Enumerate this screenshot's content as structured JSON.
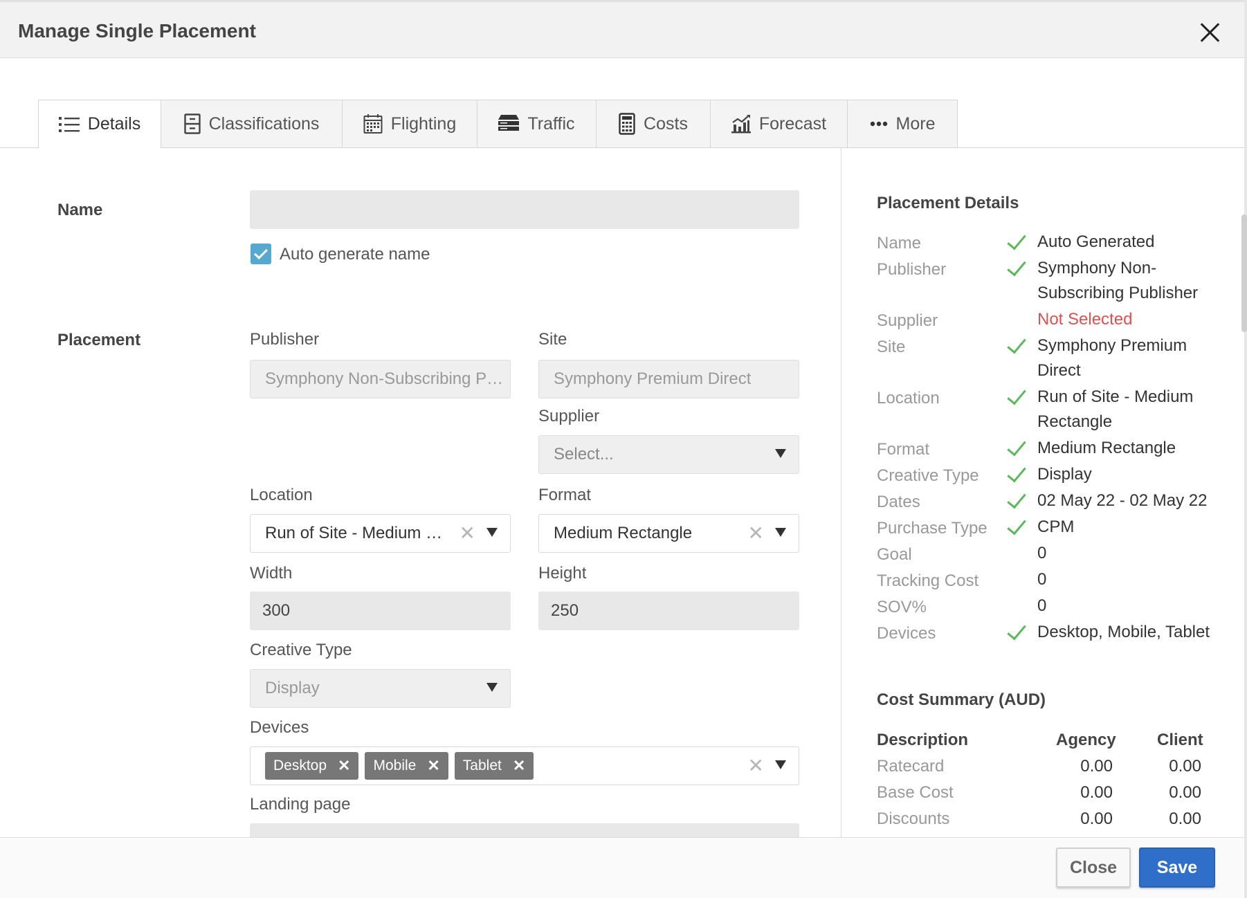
{
  "dialog": {
    "title": "Manage Single Placement"
  },
  "tabs": [
    {
      "label": "Details",
      "icon": "list-icon"
    },
    {
      "label": "Classifications",
      "icon": "cabinet-icon"
    },
    {
      "label": "Flighting",
      "icon": "calendar-icon"
    },
    {
      "label": "Traffic",
      "icon": "server-icon"
    },
    {
      "label": "Costs",
      "icon": "calculator-icon"
    },
    {
      "label": "Forecast",
      "icon": "chart-icon"
    },
    {
      "label": "More",
      "icon": "ellipsis-icon"
    }
  ],
  "form": {
    "name_section": "Name",
    "name_value": "",
    "auto_generate_label": "Auto generate name",
    "placement_section": "Placement",
    "publisher_label": "Publisher",
    "publisher_value": "Symphony Non-Subscribing Pub...",
    "site_label": "Site",
    "site_value": "Symphony Premium Direct",
    "supplier_label": "Supplier",
    "supplier_placeholder": "Select...",
    "location_label": "Location",
    "location_value": "Run of Site - Medium Re...",
    "format_label": "Format",
    "format_value": "Medium Rectangle",
    "width_label": "Width",
    "width_value": "300",
    "height_label": "Height",
    "height_value": "250",
    "creative_type_label": "Creative Type",
    "creative_type_value": "Display",
    "devices_label": "Devices",
    "devices": [
      "Desktop",
      "Mobile",
      "Tablet"
    ],
    "landing_page_label": "Landing page"
  },
  "placement_details": {
    "title": "Placement Details",
    "rows": [
      {
        "label": "Name",
        "value": "Auto Generated",
        "status": "check"
      },
      {
        "label": "Publisher",
        "value_lines": [
          "Symphony Non-",
          "Subscribing Publisher"
        ],
        "status": "check"
      },
      {
        "label": "Supplier",
        "value": "Not Selected",
        "status": "error"
      },
      {
        "label": "Site",
        "value_lines": [
          "Symphony Premium",
          "Direct"
        ],
        "status": "check"
      },
      {
        "label": "Location",
        "value_lines": [
          "Run of Site - Medium",
          "Rectangle"
        ],
        "status": "check"
      },
      {
        "label": "Format",
        "value": "Medium Rectangle",
        "status": "check"
      },
      {
        "label": "Creative Type",
        "value": "Display",
        "status": "check"
      },
      {
        "label": "Dates",
        "value": "02 May 22 - 02 May 22",
        "status": "check"
      },
      {
        "label": "Purchase Type",
        "value": "CPM",
        "status": "check"
      },
      {
        "label": "Goal",
        "value": "0",
        "status": "none"
      },
      {
        "label": "Tracking Cost",
        "value": "0",
        "status": "none"
      },
      {
        "label": "SOV%",
        "value": "0",
        "status": "none"
      },
      {
        "label": "Devices",
        "value": "Desktop, Mobile, Tablet",
        "status": "check"
      }
    ]
  },
  "cost_summary": {
    "title": "Cost Summary (AUD)",
    "headers": [
      "Description",
      "Agency",
      "Client"
    ],
    "rows": [
      {
        "description": "Ratecard",
        "agency": "0.00",
        "client": "0.00"
      },
      {
        "description": "Base Cost",
        "agency": "0.00",
        "client": "0.00"
      },
      {
        "description": "Discounts",
        "agency": "0.00",
        "client": "0.00"
      }
    ]
  },
  "footer": {
    "close_label": "Close",
    "save_label": "Save"
  },
  "colors": {
    "primary": "#2f6fc9",
    "check": "#5cb85c",
    "error": "#d9534f",
    "checkbox": "#57a8cf"
  }
}
